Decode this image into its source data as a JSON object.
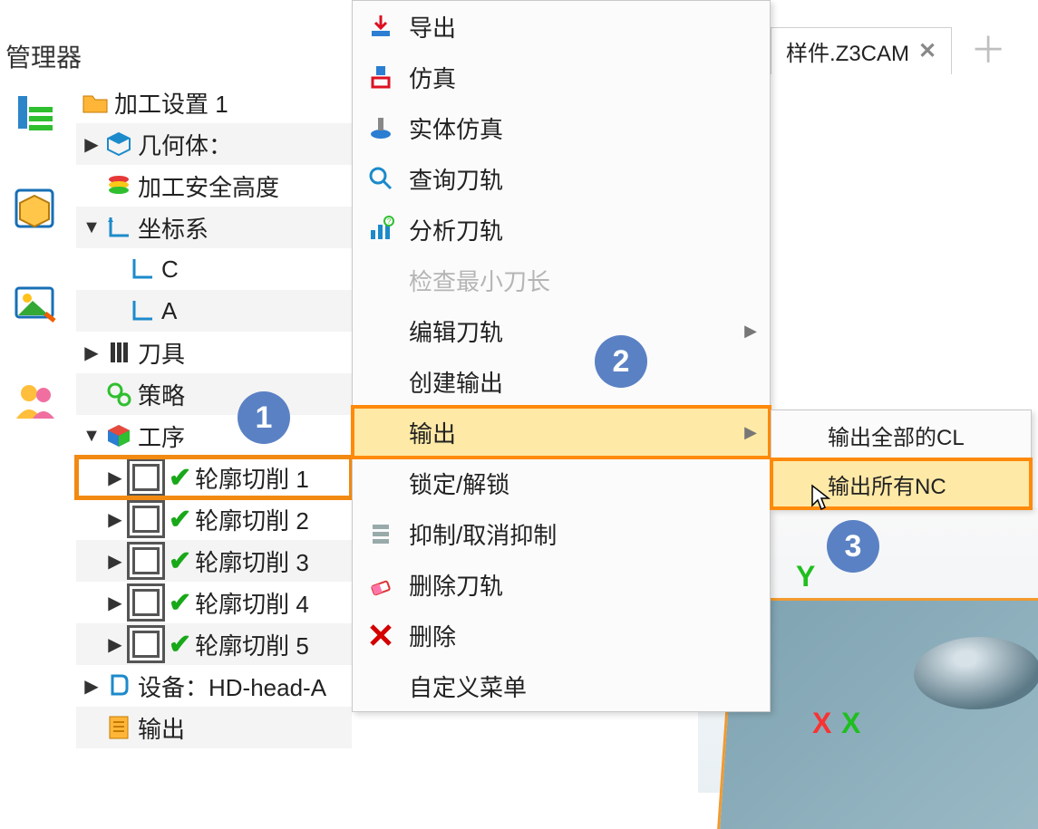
{
  "panel_title": "管理器",
  "tab": {
    "label": "样件.Z3CAM"
  },
  "tree": {
    "root": "加工设置 1",
    "geometry": "几何体：",
    "safety": "加工安全高度",
    "csys": "坐标系",
    "csys_children": [
      "C",
      "A"
    ],
    "tools": "刀具",
    "strategy": "策略",
    "ops": "工序",
    "ops_children": [
      "轮廓切削 1",
      "轮廓切削 2",
      "轮廓切削 3",
      "轮廓切削 4",
      "轮廓切削 5"
    ],
    "device": "设备：HD-head-A",
    "output": "输出"
  },
  "menu": {
    "items": [
      "导出",
      "仿真",
      "实体仿真",
      "查询刀轨",
      "分析刀轨",
      "检查最小刀长",
      "编辑刀轨",
      "创建输出",
      "输出",
      "锁定/解锁",
      "抑制/取消抑制",
      "删除刀轨",
      "删除",
      "自定义菜单"
    ]
  },
  "submenu": {
    "items": [
      "输出全部的CL",
      "输出所有NC"
    ]
  },
  "axes": {
    "y": "Y",
    "x1": "X",
    "x2": "X"
  },
  "annotations": [
    "1",
    "2",
    "3"
  ]
}
